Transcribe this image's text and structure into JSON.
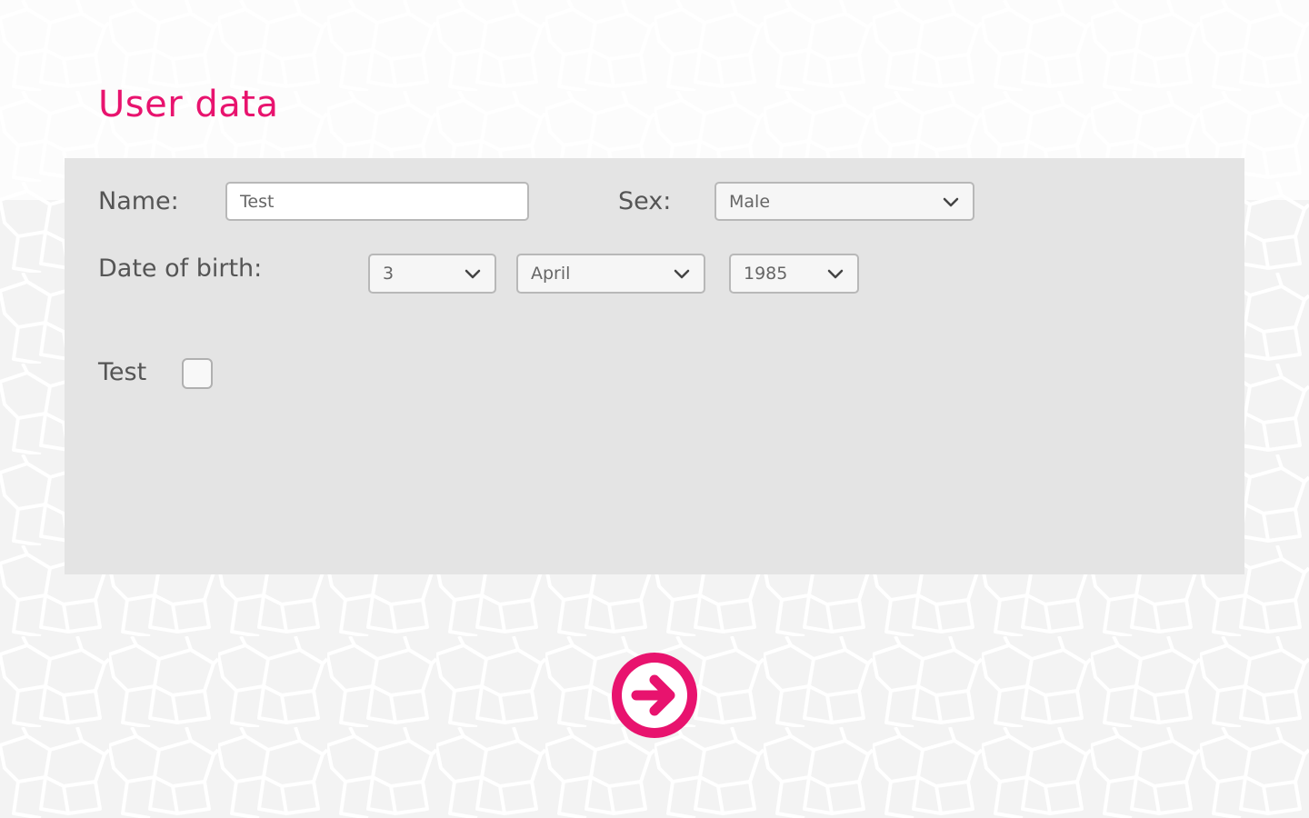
{
  "page": {
    "title": "User data"
  },
  "form": {
    "name_label": "Name:",
    "name_value": "Test",
    "sex_label": "Sex:",
    "sex_value": "Male",
    "dob_label": "Date of birth:",
    "dob_day": "3",
    "dob_month": "April",
    "dob_year": "1985",
    "test_label": "Test",
    "test_checked": false
  },
  "icons": {
    "next": "arrow-right-circle-icon",
    "dropdown": "chevron-down-icon"
  },
  "colors": {
    "accent": "#e8136e",
    "panel": "#e4e4e4",
    "text": "#555555"
  }
}
